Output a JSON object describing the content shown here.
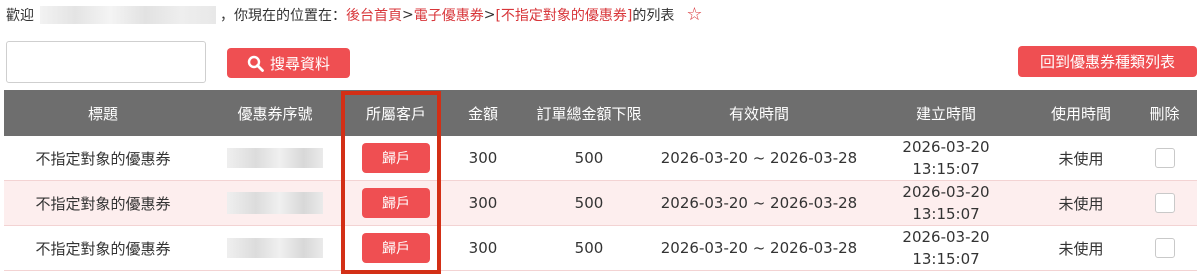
{
  "breadcrumb": {
    "welcome": "歡迎",
    "location_prefix": "，你現在的位置在：",
    "home": "後台首頁",
    "sep1": ">",
    "section": "電子優惠券",
    "sep2": ">",
    "current": "[不指定對象的優惠券]",
    "suffix": " 的列表",
    "icon": "star-outline-icon"
  },
  "search": {
    "input_value": "",
    "button_label": "搜尋資料",
    "button_icon": "search-icon"
  },
  "back_button_label": "回到優惠券種類列表",
  "table": {
    "headers": [
      "標題",
      "優惠券序號",
      "所屬客戶",
      "金額",
      "訂單總金額下限",
      "有效時間",
      "建立時間",
      "使用時間",
      "刪除"
    ],
    "rows": [
      {
        "title": "不指定對象的優惠券",
        "assign_label": "歸戶",
        "amount": "300",
        "min_order": "500",
        "valid": "2026-03-20 ~ 2026-03-28",
        "created_date": "2026-03-20",
        "created_time": "13:15:07",
        "used": "未使用"
      },
      {
        "title": "不指定對象的優惠券",
        "assign_label": "歸戶",
        "amount": "300",
        "min_order": "500",
        "valid": "2026-03-20 ~ 2026-03-28",
        "created_date": "2026-03-20",
        "created_time": "13:15:07",
        "used": "未使用"
      },
      {
        "title": "不指定對象的優惠券",
        "assign_label": "歸戶",
        "amount": "300",
        "min_order": "500",
        "valid": "2026-03-20 ~ 2026-03-28",
        "created_date": "2026-03-20",
        "created_time": "13:15:07",
        "used": "未使用"
      }
    ]
  },
  "colors": {
    "accent": "#ef4f52",
    "header_bg": "#6e6e6e",
    "highlight": "#d32f16",
    "row_alt": "#fdeeee"
  }
}
